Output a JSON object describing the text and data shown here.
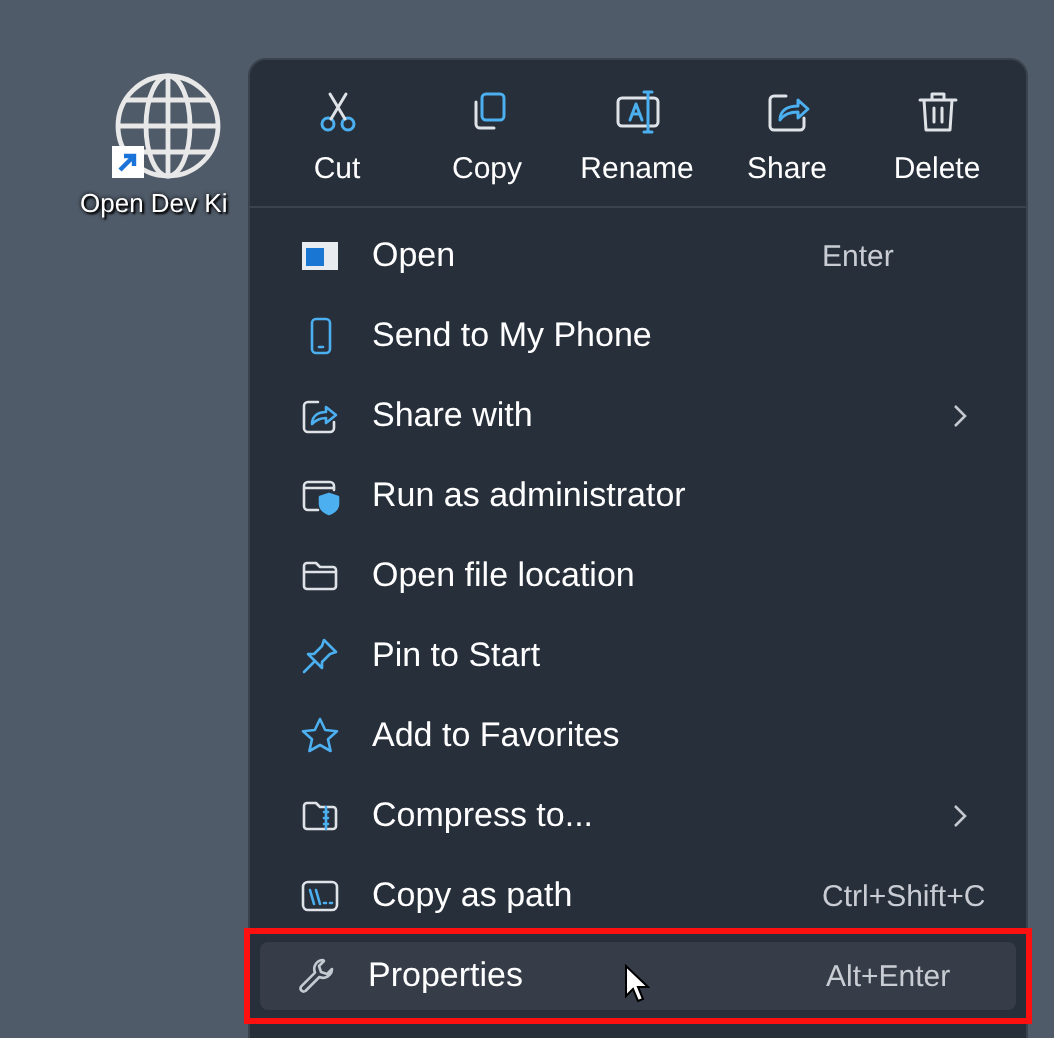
{
  "desktop_icon": {
    "label": "Open Dev Ki"
  },
  "toolbar": [
    {
      "label": "Cut"
    },
    {
      "label": "Copy"
    },
    {
      "label": "Rename"
    },
    {
      "label": "Share"
    },
    {
      "label": "Delete"
    }
  ],
  "items": [
    {
      "label": "Open",
      "shortcut": "Enter",
      "submenu": false,
      "selected": false,
      "outlined": false
    },
    {
      "label": "Send to My Phone",
      "submenu": false,
      "selected": false,
      "outlined": false
    },
    {
      "label": "Share with",
      "submenu": true,
      "selected": false,
      "outlined": false
    },
    {
      "label": "Run as administrator",
      "submenu": false,
      "selected": false,
      "outlined": false
    },
    {
      "label": "Open file location",
      "submenu": false,
      "selected": false,
      "outlined": false
    },
    {
      "label": "Pin to Start",
      "submenu": false,
      "selected": false,
      "outlined": false
    },
    {
      "label": "Add to Favorites",
      "submenu": false,
      "selected": false,
      "outlined": false
    },
    {
      "label": "Compress to...",
      "submenu": true,
      "selected": false,
      "outlined": false
    },
    {
      "label": "Copy as path",
      "shortcut": "Ctrl+Shift+C",
      "submenu": false,
      "selected": false,
      "outlined": false
    },
    {
      "label": "Properties",
      "shortcut": "Alt+Enter",
      "submenu": false,
      "selected": true,
      "outlined": true
    }
  ]
}
